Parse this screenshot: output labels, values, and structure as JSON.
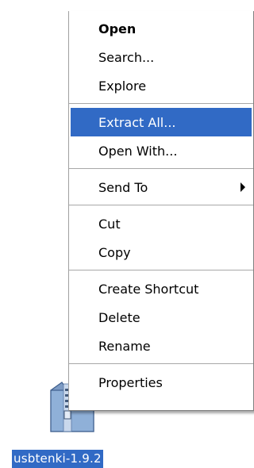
{
  "desktop": {
    "file": {
      "name": "usbtenki-1.9.2",
      "icon": "zip-folder-icon"
    }
  },
  "context_menu": {
    "highlight_color": "#316ac5",
    "groups": [
      [
        {
          "label": "Open",
          "bold": true
        },
        {
          "label": "Search..."
        },
        {
          "label": "Explore"
        }
      ],
      [
        {
          "label": "Extract All...",
          "highlighted": true
        },
        {
          "label": "Open With..."
        }
      ],
      [
        {
          "label": "Send To",
          "submenu": true,
          "submenu_icon": "chevron-right-icon"
        }
      ],
      [
        {
          "label": "Cut"
        },
        {
          "label": "Copy"
        }
      ],
      [
        {
          "label": "Create Shortcut"
        },
        {
          "label": "Delete"
        },
        {
          "label": "Rename"
        }
      ],
      [
        {
          "label": "Properties"
        }
      ]
    ]
  }
}
